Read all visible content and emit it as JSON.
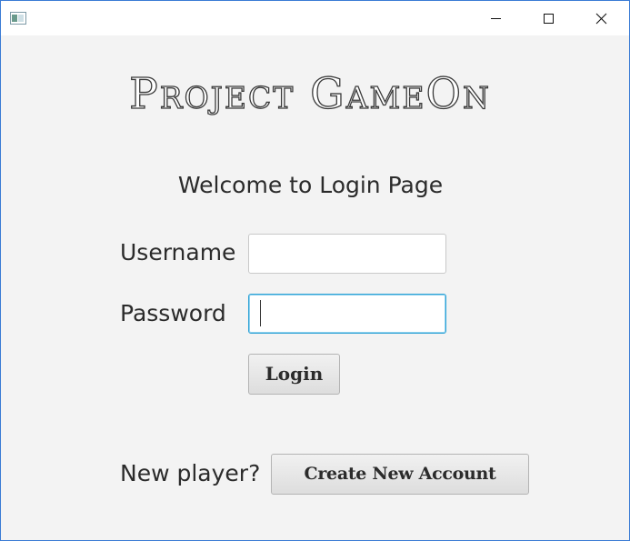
{
  "window": {
    "title_bar": {
      "icon": "app-window-icon",
      "controls": {
        "minimize_icon": "minimize-icon",
        "maximize_icon": "maximize-icon",
        "close_icon": "close-icon"
      }
    }
  },
  "app": {
    "title": "Project GameOn"
  },
  "login": {
    "welcome": "Welcome to Login Page",
    "username_label": "Username",
    "username_value": "",
    "password_label": "Password",
    "password_value": "",
    "login_button": "Login"
  },
  "signup": {
    "prompt": "New player?",
    "create_button": "Create New Account"
  },
  "colors": {
    "background": "#f3f3f3",
    "title_bar": "#ffffff",
    "window_border": "#3a7bd5",
    "focus_border": "#2fa3d6",
    "text": "#2b2b2b"
  }
}
